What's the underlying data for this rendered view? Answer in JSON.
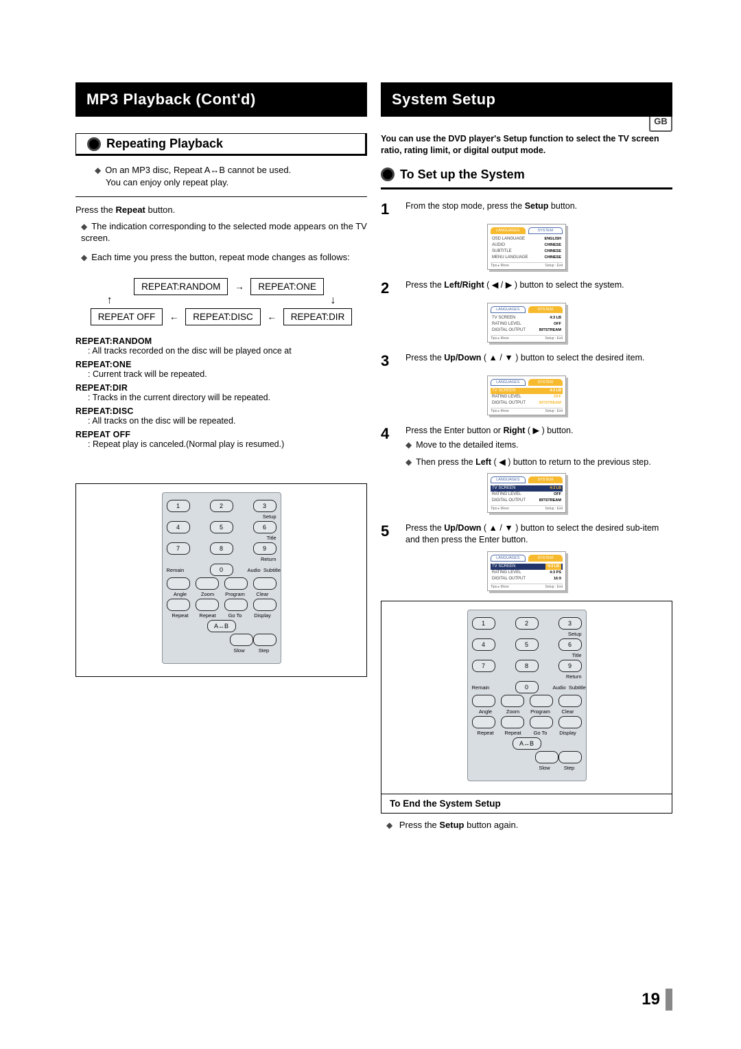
{
  "badge": "GB",
  "pageNumber": "19",
  "left": {
    "header": "MP3 Playback (Cont'd)",
    "section": "Repeating Playback",
    "note1": "On an MP3 disc, Repeat A↔B cannot be used.",
    "note2": "You can enjoy only repeat play.",
    "pressPrefix": "Press the ",
    "repeatWord": "Repeat",
    "pressSuffix": " button.",
    "bullet1": "The indication corresponding to the selected mode appears on the TV screen.",
    "bullet2": "Each time you press the button, repeat mode changes as follows:",
    "flow": {
      "random": "REPEAT:RANDOM",
      "one": "REPEAT:ONE",
      "off": "REPEAT OFF",
      "disc": "REPEAT:DISC",
      "dir": "REPEAT:DIR"
    },
    "defs": [
      {
        "term": "REPEAT:RANDOM",
        "desc": ": All tracks recorded on the disc will be played once at"
      },
      {
        "term": "REPEAT:ONE",
        "desc": ": Current track will be repeated."
      },
      {
        "term": "REPEAT:DIR",
        "desc": ": Tracks in the current directory will be repeated."
      },
      {
        "term": "REPEAT:DISC",
        "desc": ": All tracks on the disc will be repeated."
      },
      {
        "term": "REPEAT OFF",
        "desc": ": Repeat play is canceled.(Normal play is resumed.)"
      }
    ]
  },
  "remote": {
    "sideLabels": [
      "Setup",
      "Title",
      "Return",
      "Remain",
      "Audio",
      "Subtitle",
      "Angle",
      "Zoom",
      "Program",
      "Clear",
      "Repeat",
      "Repeat",
      "Go To",
      "Display",
      "A↔B",
      "Slow",
      "Step"
    ]
  },
  "right": {
    "header": "System Setup",
    "intro": "You can use the DVD player's Setup function to select the TV screen ratio, rating limit, or digital output mode.",
    "section": "To Set up the System",
    "steps": {
      "s1_pre": "From the stop mode, press the ",
      "s1_b": "Setup",
      "s1_post": " button.",
      "s2_pre": "Press the ",
      "s2_b": "Left/Right",
      "s2_mid": " ( ◀ / ▶ ) button to select the system.",
      "s3_pre": "Press the ",
      "s3_b": "Up/Down",
      "s3_mid": " ( ▲ / ▼ ) button to select the desired item.",
      "s4_pre": "Press the Enter button or ",
      "s4_b": "Right",
      "s4_post": " ( ▶ ) button.",
      "s4_sub1": "Move to the detailed items.",
      "s4_sub2_pre": "Then press the ",
      "s4_sub2_b": "Left",
      "s4_sub2_post": " ( ◀ ) button to return to the previous step.",
      "s5_pre": "Press the ",
      "s5_b": "Up/Down",
      "s5_mid": " ( ▲ / ▼ ) button to select the desired sub-item and then press the Enter button."
    },
    "screens": {
      "tabLang": "LANGUAGES",
      "tabSys": "SYSTEM",
      "langRows": [
        [
          "OSD LANGUAGE",
          "ENGLISH"
        ],
        [
          "AUDIO",
          "CHINESE"
        ],
        [
          "SUBTITLE",
          "CHINESE"
        ],
        [
          "MENU LANGUAGE",
          "CHINESE"
        ]
      ],
      "sysRows": [
        [
          "TV SCREEN",
          "4:3 LB"
        ],
        [
          "RATING LEVEL",
          "OFF"
        ],
        [
          "DIGITAL OUTPUT",
          "BITSTREAM"
        ]
      ],
      "sysScreen5": [
        [
          "TV SCREEN",
          "4:3 LB"
        ],
        [
          "RATING LEVEL",
          "4:3 PS"
        ],
        [
          "DIGITAL OUTPUT",
          "16:9"
        ]
      ],
      "footerL": "Tips ▸ Move",
      "footerR": "Setup : Exit"
    },
    "endTitle": "To End the System Setup",
    "endText_pre": "Press the ",
    "endText_b": "Setup",
    "endText_post": " button again."
  }
}
